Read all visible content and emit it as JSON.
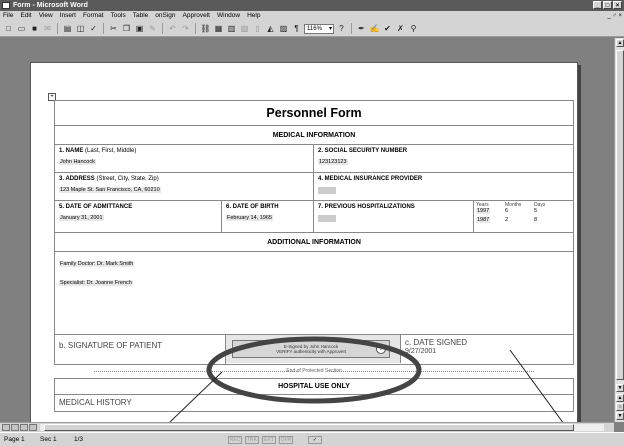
{
  "window": {
    "title": "Form - Microsoft Word",
    "controls": [
      "_",
      "□",
      "×"
    ]
  },
  "menu": {
    "items": [
      "File",
      "Edit",
      "View",
      "Insert",
      "Format",
      "Tools",
      "Table",
      " onSign",
      "Approvelt",
      "Window",
      "Help"
    ],
    "mdi_controls": "_ ♂ ×"
  },
  "toolbar": {
    "zoom": "116%"
  },
  "form": {
    "title": "Personnel Form",
    "medical_header": "MEDICAL INFORMATION",
    "name": {
      "label": "1.  NAME",
      "hint": "(Last, First, Middle)",
      "value": "John Hancock"
    },
    "ssn": {
      "label": "2.  SOCIAL SECURITY NUMBER",
      "value": "123123123"
    },
    "address": {
      "label": "3.  ADDRESS",
      "hint": "(Street, City, State, Zip)",
      "value": "123 Maple St. San Francisco, CA, 60210"
    },
    "insurance": {
      "label": "4.  MEDICAL INSURANCE PROVIDER"
    },
    "admittance": {
      "label": "5.  DATE OF ADMITTANCE",
      "value": "January 31, 2001"
    },
    "birth": {
      "label": "6.  DATE OF BIRTH",
      "value": "February 14, 1965"
    },
    "prev_hosp": {
      "label": "7.  PREVIOUS HOSPITALIZATIONS",
      "headers": [
        "Years",
        "Months",
        "Days"
      ],
      "rows": [
        [
          "1997",
          "6",
          "5"
        ],
        [
          "1987",
          "2",
          "8"
        ]
      ]
    },
    "additional_header": "ADDITIONAL INFORMATION",
    "family_doctor": "Family Doctor: Dr. Mark Smith",
    "specialist": "Specialist: Dr. Joanne French",
    "signature_label": "b. SIGNATURE OF PATIENT",
    "stamp_line1": "E-Signed by John Hancock",
    "stamp_line2": "VERIFY authenticity with ApproveIt",
    "stamp_badge": "?",
    "date_signed_label": "c. DATE SIGNED",
    "date_signed_value": "9/27/2001",
    "protected_text": "End of Protected Section",
    "hospital_header": "HOSPITAL USE ONLY",
    "medical_history": "MEDICAL HISTORY"
  },
  "status": {
    "page": "Page 1",
    "sec": "Sec 1",
    "pages": "1/3",
    "indicators": [
      "REC",
      "TRK",
      "EXT",
      "OVR"
    ]
  }
}
